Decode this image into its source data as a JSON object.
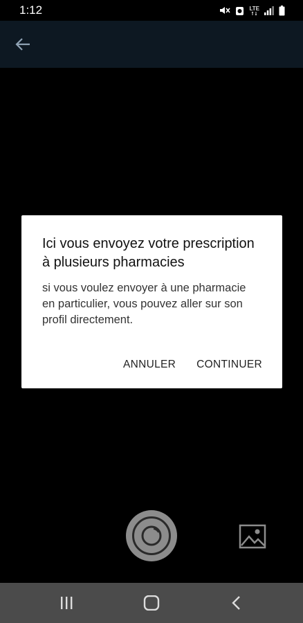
{
  "status_bar": {
    "time": "1:12",
    "network_label": "LTE",
    "icons": [
      "mute-icon",
      "alarm-icon",
      "lte-icon",
      "signal-icon",
      "battery-icon"
    ]
  },
  "app_bar": {
    "back_icon": "arrow-left-icon",
    "background_color": "#0d1822"
  },
  "dialog": {
    "title": "Ici vous envoyez votre prescription à plusieurs pharmacies",
    "message": "si vous voulez envoyer à une pharmacie en particulier, vous pouvez aller sur son profil directement.",
    "cancel_label": "ANNULER",
    "continue_label": "CONTINUER"
  },
  "camera": {
    "shutter_icon": "camera-shutter-icon",
    "gallery_icon": "image-gallery-icon"
  },
  "nav_bar": {
    "icons": [
      "recent-apps-icon",
      "home-icon",
      "back-icon"
    ]
  }
}
